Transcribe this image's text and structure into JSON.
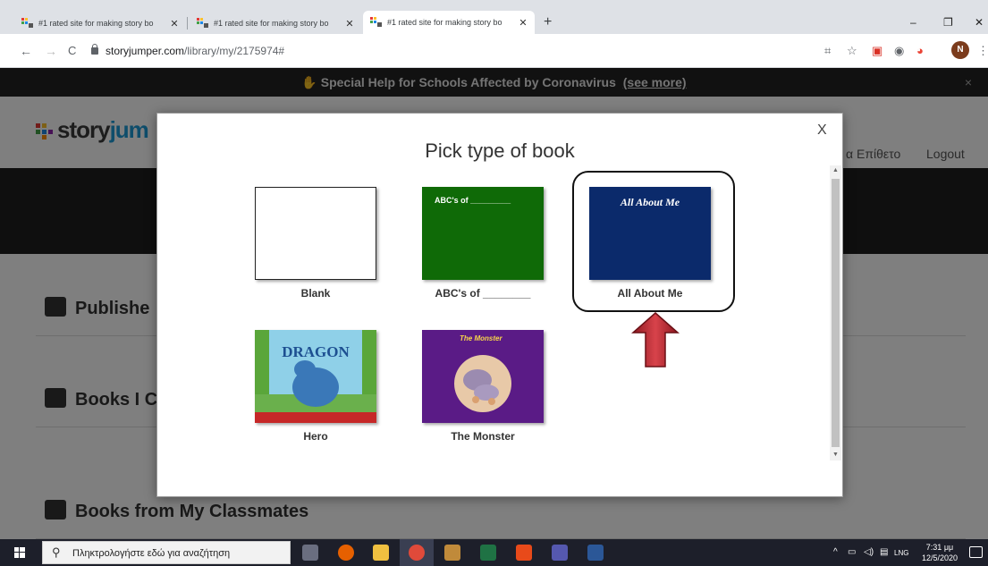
{
  "browser": {
    "tabs": [
      {
        "title": "#1 rated site for making story bo",
        "close": "✕"
      },
      {
        "title": "#1 rated site for making story bo",
        "close": "✕"
      },
      {
        "title": "#1 rated site for making story bo",
        "close": "✕"
      }
    ],
    "new_tab": "+",
    "window_controls": {
      "minimize": "–",
      "maximize": "❐",
      "close": "✕"
    },
    "nav": {
      "back": "←",
      "forward": "→",
      "reload": "C"
    },
    "url_host": "storyjumper.com",
    "url_path": "/library/my/2175974#",
    "toolbar_icons": [
      "translate-icon",
      "star-icon",
      "pocket-icon",
      "circle-extension-icon",
      "chrome-extension-icon"
    ],
    "profile_initial": "N",
    "menu": "⋮"
  },
  "site": {
    "banner_text": "Special Help for Schools Affected by Coronavirus",
    "banner_link": "(see more)",
    "banner_close": "×",
    "logo_story": "story",
    "logo_jump": "jum",
    "header_links": {
      "account": "α Επίθετο",
      "logout": "Logout"
    },
    "sections": [
      {
        "label": "Publishe"
      },
      {
        "label": "Books I C"
      },
      {
        "label": "Books from My Classmates"
      }
    ]
  },
  "modal": {
    "title": "Pick type of book",
    "close": "X",
    "books": [
      {
        "caption": "Blank",
        "cover_text": ""
      },
      {
        "caption": "ABC's of ________",
        "cover_text": "ABC's of _________"
      },
      {
        "caption": "All About Me",
        "cover_text": "All About Me"
      },
      {
        "caption": "Hero",
        "cover_text": "DRAGON"
      },
      {
        "caption": "The Monster",
        "cover_text": "The Monster"
      }
    ],
    "highlighted_book": "All About Me"
  },
  "colors": {
    "abc_cover": "#0f6a07",
    "about_cover": "#0b2a6b",
    "monster_cover": "#5a1b86",
    "arrow": "#b5242c"
  },
  "taskbar": {
    "search_placeholder": "Πληκτρολογήστε εδώ για αναζήτηση",
    "apps": [
      "task-view-icon",
      "firefox-icon",
      "file-explorer-icon",
      "chrome-icon",
      "package-icon",
      "excel-icon",
      "office-icon",
      "teams-icon",
      "word-icon"
    ],
    "tray_lang": "LNG",
    "time": "7:31 μμ",
    "date": "12/5/2020"
  }
}
